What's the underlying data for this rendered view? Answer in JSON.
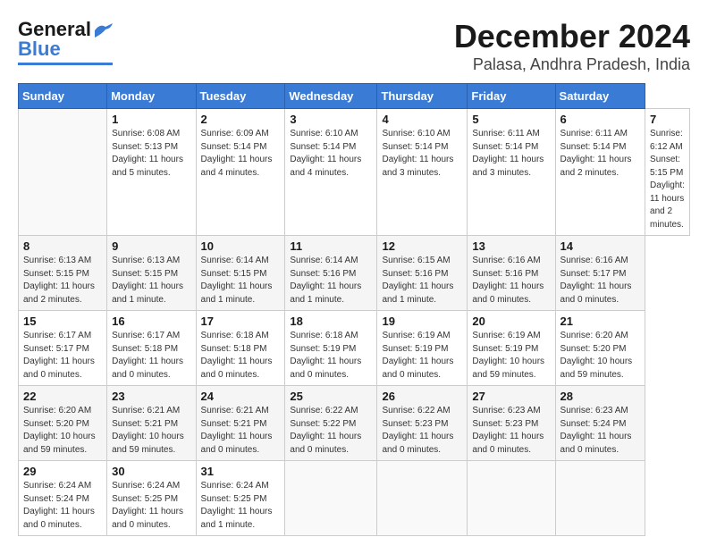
{
  "header": {
    "logo_general": "General",
    "logo_blue": "Blue",
    "month": "December 2024",
    "location": "Palasa, Andhra Pradesh, India"
  },
  "calendar": {
    "days_of_week": [
      "Sunday",
      "Monday",
      "Tuesday",
      "Wednesday",
      "Thursday",
      "Friday",
      "Saturday"
    ],
    "weeks": [
      [
        null,
        {
          "day": "1",
          "sunrise": "6:08 AM",
          "sunset": "5:13 PM",
          "daylight": "11 hours and 5 minutes."
        },
        {
          "day": "2",
          "sunrise": "6:09 AM",
          "sunset": "5:14 PM",
          "daylight": "11 hours and 4 minutes."
        },
        {
          "day": "3",
          "sunrise": "6:10 AM",
          "sunset": "5:14 PM",
          "daylight": "11 hours and 4 minutes."
        },
        {
          "day": "4",
          "sunrise": "6:10 AM",
          "sunset": "5:14 PM",
          "daylight": "11 hours and 3 minutes."
        },
        {
          "day": "5",
          "sunrise": "6:11 AM",
          "sunset": "5:14 PM",
          "daylight": "11 hours and 3 minutes."
        },
        {
          "day": "6",
          "sunrise": "6:11 AM",
          "sunset": "5:14 PM",
          "daylight": "11 hours and 2 minutes."
        },
        {
          "day": "7",
          "sunrise": "6:12 AM",
          "sunset": "5:15 PM",
          "daylight": "11 hours and 2 minutes."
        }
      ],
      [
        {
          "day": "8",
          "sunrise": "6:13 AM",
          "sunset": "5:15 PM",
          "daylight": "11 hours and 2 minutes."
        },
        {
          "day": "9",
          "sunrise": "6:13 AM",
          "sunset": "5:15 PM",
          "daylight": "11 hours and 1 minute."
        },
        {
          "day": "10",
          "sunrise": "6:14 AM",
          "sunset": "5:15 PM",
          "daylight": "11 hours and 1 minute."
        },
        {
          "day": "11",
          "sunrise": "6:14 AM",
          "sunset": "5:16 PM",
          "daylight": "11 hours and 1 minute."
        },
        {
          "day": "12",
          "sunrise": "6:15 AM",
          "sunset": "5:16 PM",
          "daylight": "11 hours and 1 minute."
        },
        {
          "day": "13",
          "sunrise": "6:16 AM",
          "sunset": "5:16 PM",
          "daylight": "11 hours and 0 minutes."
        },
        {
          "day": "14",
          "sunrise": "6:16 AM",
          "sunset": "5:17 PM",
          "daylight": "11 hours and 0 minutes."
        }
      ],
      [
        {
          "day": "15",
          "sunrise": "6:17 AM",
          "sunset": "5:17 PM",
          "daylight": "11 hours and 0 minutes."
        },
        {
          "day": "16",
          "sunrise": "6:17 AM",
          "sunset": "5:18 PM",
          "daylight": "11 hours and 0 minutes."
        },
        {
          "day": "17",
          "sunrise": "6:18 AM",
          "sunset": "5:18 PM",
          "daylight": "11 hours and 0 minutes."
        },
        {
          "day": "18",
          "sunrise": "6:18 AM",
          "sunset": "5:19 PM",
          "daylight": "11 hours and 0 minutes."
        },
        {
          "day": "19",
          "sunrise": "6:19 AM",
          "sunset": "5:19 PM",
          "daylight": "11 hours and 0 minutes."
        },
        {
          "day": "20",
          "sunrise": "6:19 AM",
          "sunset": "5:19 PM",
          "daylight": "10 hours and 59 minutes."
        },
        {
          "day": "21",
          "sunrise": "6:20 AM",
          "sunset": "5:20 PM",
          "daylight": "10 hours and 59 minutes."
        }
      ],
      [
        {
          "day": "22",
          "sunrise": "6:20 AM",
          "sunset": "5:20 PM",
          "daylight": "10 hours and 59 minutes."
        },
        {
          "day": "23",
          "sunrise": "6:21 AM",
          "sunset": "5:21 PM",
          "daylight": "10 hours and 59 minutes."
        },
        {
          "day": "24",
          "sunrise": "6:21 AM",
          "sunset": "5:21 PM",
          "daylight": "11 hours and 0 minutes."
        },
        {
          "day": "25",
          "sunrise": "6:22 AM",
          "sunset": "5:22 PM",
          "daylight": "11 hours and 0 minutes."
        },
        {
          "day": "26",
          "sunrise": "6:22 AM",
          "sunset": "5:23 PM",
          "daylight": "11 hours and 0 minutes."
        },
        {
          "day": "27",
          "sunrise": "6:23 AM",
          "sunset": "5:23 PM",
          "daylight": "11 hours and 0 minutes."
        },
        {
          "day": "28",
          "sunrise": "6:23 AM",
          "sunset": "5:24 PM",
          "daylight": "11 hours and 0 minutes."
        }
      ],
      [
        {
          "day": "29",
          "sunrise": "6:24 AM",
          "sunset": "5:24 PM",
          "daylight": "11 hours and 0 minutes."
        },
        {
          "day": "30",
          "sunrise": "6:24 AM",
          "sunset": "5:25 PM",
          "daylight": "11 hours and 0 minutes."
        },
        {
          "day": "31",
          "sunrise": "6:24 AM",
          "sunset": "5:25 PM",
          "daylight": "11 hours and 1 minute."
        },
        null,
        null,
        null,
        null
      ]
    ]
  }
}
